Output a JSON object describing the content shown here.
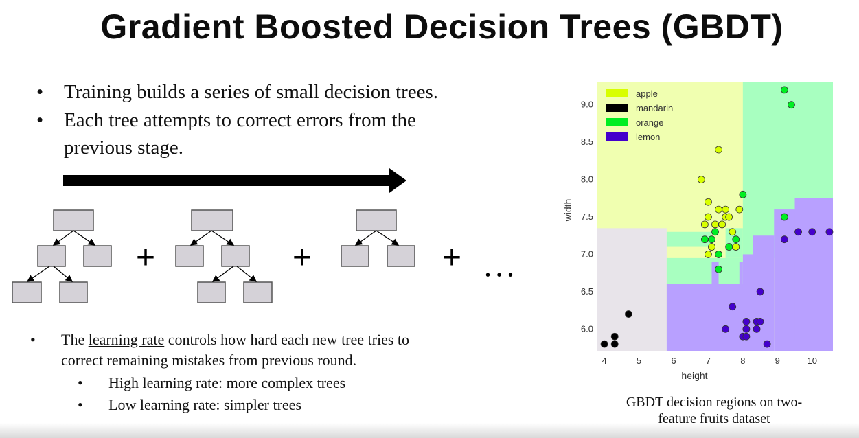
{
  "slide": {
    "title": "Gradient Boosted Decision Trees (GBDT)",
    "bullet_char": "•",
    "bullets": [
      "Training builds a series of small decision trees.",
      "Each tree attempts to correct errors from the",
      "previous stage."
    ],
    "learning_rate": {
      "prefix": "The ",
      "term": "learning rate",
      "suffix": " controls how hard each new tree tries to",
      "line2": "correct remaining mistakes from previous round.",
      "high": "High learning rate: more complex trees",
      "low": "Low learning rate: simpler trees"
    },
    "plus_sign": "+",
    "ellipsis": "• • •",
    "caption_line1": "GBDT decision regions on two-",
    "caption_line2": "feature fruits dataset"
  },
  "chart_data": {
    "type": "scatter",
    "xlabel": "height",
    "ylabel": "width",
    "xlim": [
      3.8,
      10.6
    ],
    "ylim": [
      5.7,
      9.3
    ],
    "x_ticks": [
      4,
      5,
      6,
      7,
      8,
      9,
      10
    ],
    "y_ticks": [
      6.0,
      6.5,
      7.0,
      7.5,
      8.0,
      8.5,
      9.0
    ],
    "legend_position": "top-left",
    "grid": false,
    "series": [
      {
        "name": "apple",
        "color": "#d8ff00",
        "region_color": "#f0ffb0",
        "points": [
          [
            7.3,
            8.4
          ],
          [
            6.8,
            8.0
          ],
          [
            7.0,
            7.7
          ],
          [
            7.3,
            7.6
          ],
          [
            7.5,
            7.6
          ],
          [
            7.9,
            7.6
          ],
          [
            7.0,
            7.5
          ],
          [
            7.5,
            7.5
          ],
          [
            7.6,
            7.5
          ],
          [
            6.9,
            7.4
          ],
          [
            7.2,
            7.4
          ],
          [
            7.4,
            7.4
          ],
          [
            7.7,
            7.3
          ],
          [
            7.0,
            7.0
          ],
          [
            7.8,
            7.1
          ],
          [
            7.1,
            7.1
          ]
        ]
      },
      {
        "name": "mandarin",
        "color": "#000000",
        "region_color": "#e8e4ea",
        "points": [
          [
            4.0,
            5.8
          ],
          [
            4.3,
            5.8
          ],
          [
            4.3,
            5.9
          ],
          [
            4.7,
            6.2
          ]
        ]
      },
      {
        "name": "orange",
        "color": "#00ee22",
        "region_color": "#a8ffc0",
        "points": [
          [
            9.2,
            9.2
          ],
          [
            9.4,
            9.0
          ],
          [
            8.0,
            7.8
          ],
          [
            9.2,
            7.5
          ],
          [
            6.9,
            7.2
          ],
          [
            7.1,
            7.2
          ],
          [
            7.2,
            7.3
          ],
          [
            7.6,
            7.1
          ],
          [
            7.8,
            7.2
          ],
          [
            7.3,
            7.0
          ],
          [
            7.3,
            6.8
          ]
        ]
      },
      {
        "name": "lemon",
        "color": "#4400cc",
        "region_color": "#b8a0ff",
        "points": [
          [
            9.2,
            7.2
          ],
          [
            9.6,
            7.3
          ],
          [
            10.0,
            7.3
          ],
          [
            10.5,
            7.3
          ],
          [
            8.5,
            6.5
          ],
          [
            7.7,
            6.3
          ],
          [
            8.1,
            6.1
          ],
          [
            8.4,
            6.1
          ],
          [
            8.5,
            6.1
          ],
          [
            7.5,
            6.0
          ],
          [
            8.1,
            6.0
          ],
          [
            8.4,
            6.0
          ],
          [
            8.0,
            5.9
          ],
          [
            8.1,
            5.9
          ],
          [
            8.7,
            5.8
          ]
        ]
      }
    ],
    "tick_labels": {
      "x": [
        "4",
        "5",
        "6",
        "7",
        "8",
        "9",
        "10"
      ],
      "y": [
        "6.0",
        "6.5",
        "7.0",
        "7.5",
        "8.0",
        "8.5",
        "9.0"
      ]
    }
  }
}
